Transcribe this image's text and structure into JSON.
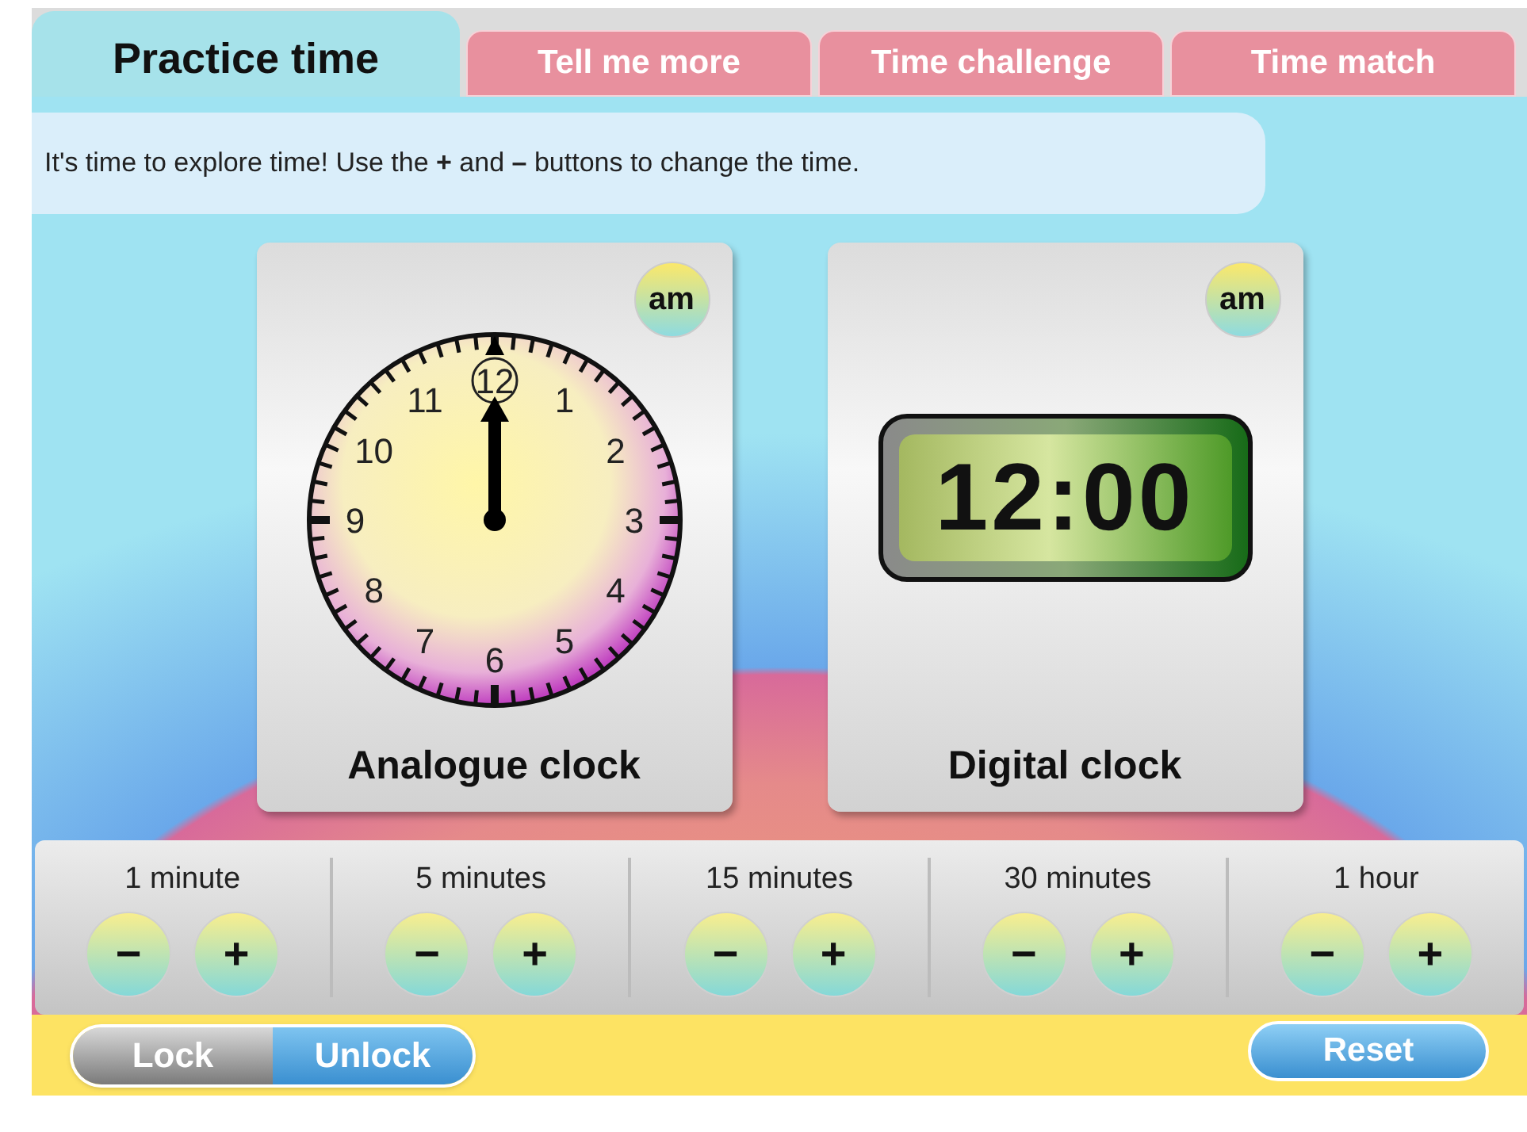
{
  "tabs": [
    {
      "label": "Practice time",
      "selected": true
    },
    {
      "label": "Tell me more",
      "selected": false
    },
    {
      "label": "Time challenge",
      "selected": false
    },
    {
      "label": "Time match",
      "selected": false
    }
  ],
  "instruction": "It's time to explore time! Use the **+** and **–** buttons to change the time.",
  "clocks": [
    {
      "kind": "analogue",
      "period": "am",
      "title": "Analogue clock",
      "dial_numbers": [
        "12",
        "1",
        "2",
        "3",
        "4",
        "5",
        "6",
        "7",
        "8",
        "9",
        "10",
        "11"
      ]
    },
    {
      "kind": "digital",
      "period": "am",
      "title": "Digital clock",
      "time": "12:00"
    }
  ],
  "steppers": [
    {
      "label": "1 minute",
      "minus": "−",
      "plus": "+"
    },
    {
      "label": "5 minutes",
      "minus": "−",
      "plus": "+"
    },
    {
      "label": "15 minutes",
      "minus": "−",
      "plus": "+"
    },
    {
      "label": "30 minutes",
      "minus": "−",
      "plus": "+"
    },
    {
      "label": "1 hour",
      "minus": "−",
      "plus": "+"
    }
  ],
  "lock_toggle": [
    {
      "label": "Lock",
      "selected": false
    },
    {
      "label": "Unlock",
      "selected": true
    }
  ],
  "reset_button": "Reset"
}
